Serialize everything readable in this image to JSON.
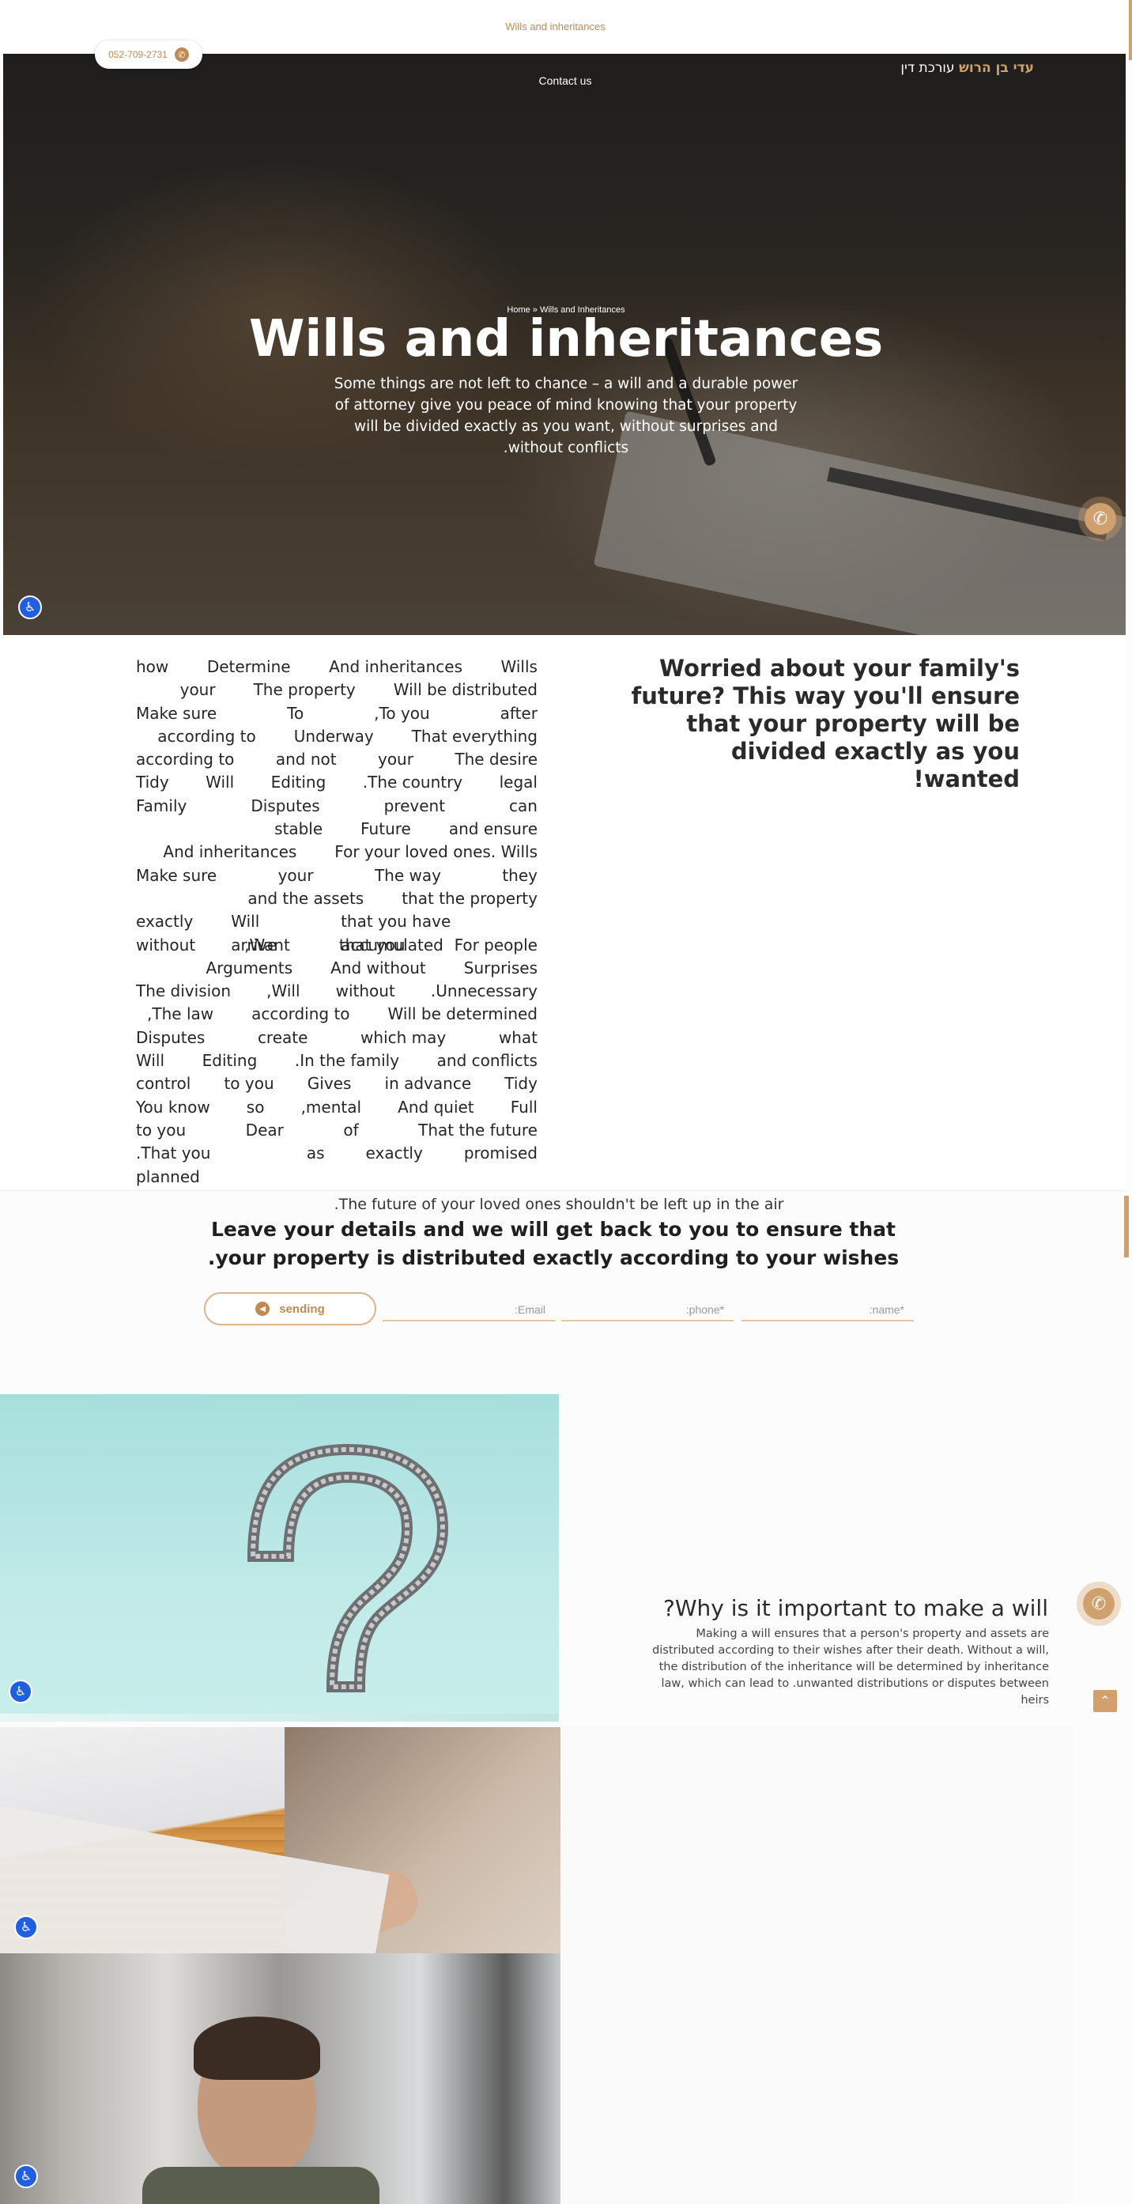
{
  "top_bar": {
    "link_label": "Wills and inheritances",
    "accent_color": "#d0a06f"
  },
  "header": {
    "phone": "052-709-2731",
    "phone_icon": "phone-icon",
    "contact_label": "Contact us",
    "logo_name": "עדי בן הרוש",
    "logo_title": "עורכת דין"
  },
  "hero": {
    "breadcrumb": "Home » Wills and Inheritances",
    "title": "Wills and inheritances",
    "description": "Some things are not left to chance – a will and a durable power of attorney give you peace of mind knowing that your property will be divided exactly as you want, without surprises and without conflicts."
  },
  "intro": {
    "heading": "Worried about your family's future? This way you'll ensure that your property will be divided exactly as you wanted!",
    "body_lines": [
      [
        "how",
        "Determine",
        "And inheritances",
        "Wills"
      ],
      [
        "your",
        "The property",
        "Will be distributed"
      ],
      [
        "Make sure",
        "To",
        ",To you",
        "after"
      ],
      [
        "according to",
        "Underway",
        "That everything"
      ],
      [
        "according to",
        "and not",
        "your",
        "The desire"
      ],
      [
        "Tidy",
        "Will",
        "Editing",
        ".The country",
        "legal"
      ],
      [
        "Family",
        "Disputes",
        "prevent",
        "can"
      ],
      [
        "stable",
        "Future",
        "and ensure"
      ],
      [
        "And inheritances",
        "For your loved ones. Wills"
      ],
      [
        "Make sure",
        "your",
        "The way",
        "they"
      ],
      [
        "and the assets",
        "that the property"
      ],
      [
        "exactly",
        "Will arrive",
        "that you have accumulated"
      ],
      [
        "without",
        ",Want",
        "that you",
        "For people"
      ],
      [
        "Arguments",
        "And without",
        "Surprises"
      ],
      [
        "The division",
        ",Will",
        "without",
        ".Unnecessary"
      ],
      [
        ",The law",
        "according to",
        "Will be determined"
      ],
      [
        "Disputes",
        "create",
        "which may",
        "what"
      ],
      [
        "Will",
        "Editing",
        ".In the family",
        "and conflicts"
      ],
      [
        "control",
        "to you",
        "Gives",
        "in advance",
        "Tidy"
      ],
      [
        "You know",
        "so",
        ",mental",
        "And quiet",
        "Full"
      ],
      [
        "to you",
        "Dear",
        "of",
        "That the future"
      ],
      [
        ".That you planned",
        "as",
        "exactly",
        "promised"
      ]
    ]
  },
  "lead_form": {
    "subtitle": ".The future of your loved ones shouldn't be left up in the air",
    "title": "Leave your details and we will get back to you to ensure that your property is distributed exactly according to your wishes.",
    "fields": {
      "name": ":name*",
      "phone": ":phone*",
      "email": ":Email"
    },
    "submit_label": "sending"
  },
  "why_section": {
    "title": "?Why is it important to make a will",
    "text": "Making a will ensures that a person's property and assets are distributed according to their wishes after their death. Without a will, the distribution of the inheritance will be determined by inheritance law, which can lead to .unwanted distributions or disputes between heirs"
  },
  "floating": {
    "call_icon": "phone-icon",
    "accessibility_icon": "accessibility-icon",
    "scroll_top_icon": "chevron-up-icon"
  }
}
